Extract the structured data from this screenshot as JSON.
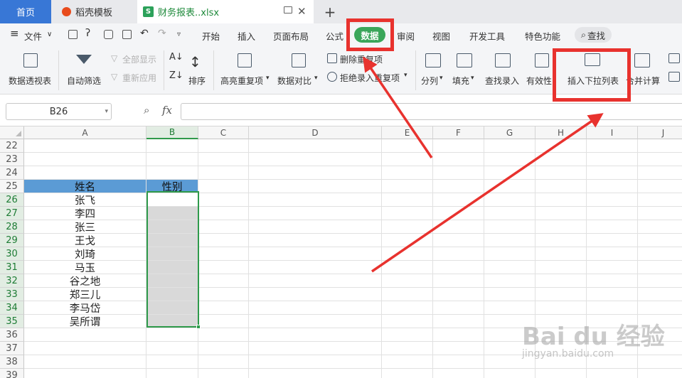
{
  "tabs": {
    "home": "首页",
    "template": "稻壳模板",
    "file": "财务报表..xlsx",
    "new_tab": "+"
  },
  "menu": {
    "file": "文件",
    "items": [
      "开始",
      "插入",
      "页面布局",
      "公式",
      "数据",
      "审阅",
      "视图",
      "开发工具",
      "特色功能"
    ],
    "active": "数据",
    "search": "查找"
  },
  "ribbon": {
    "pivot": "数据透视表",
    "autofilter": "自动筛选",
    "show_all": "全部显示",
    "reapply": "重新应用",
    "sort": "排序",
    "highlight_dup": "高亮重复项",
    "compare": "数据对比",
    "delete_dup": "删除重复项",
    "reject_dup": "拒绝录入重复项",
    "split": "分列",
    "fill": "填充",
    "lookup_entry": "查找录入",
    "validity": "有效性",
    "insert_dropdown": "插入下拉列表",
    "merge_calc": "合并计算"
  },
  "formula_bar": {
    "name_box": "B26",
    "fx": "fx"
  },
  "grid": {
    "columns": [
      "A",
      "B",
      "C",
      "D",
      "E",
      "F",
      "G",
      "H",
      "I",
      "J"
    ],
    "rows": [
      "22",
      "23",
      "24",
      "25",
      "26",
      "27",
      "28",
      "29",
      "30",
      "31",
      "32",
      "33",
      "34",
      "35",
      "36",
      "37",
      "38",
      "39"
    ],
    "header_row": {
      "a": "姓名",
      "b": "性别"
    },
    "names": [
      "张飞",
      "李四",
      "张三",
      "王戈",
      "刘琦",
      "马玉",
      "谷之地",
      "郑三儿",
      "李马岱",
      "吴所谓"
    ]
  },
  "colors": {
    "accent": "#3aa65a",
    "header_fill": "#5b9bd5",
    "selection": "#2f9a4b",
    "annotation": "#e8322e"
  },
  "watermark": {
    "main": "Bai du 经验",
    "sub": "jingyan.baidu.com"
  }
}
